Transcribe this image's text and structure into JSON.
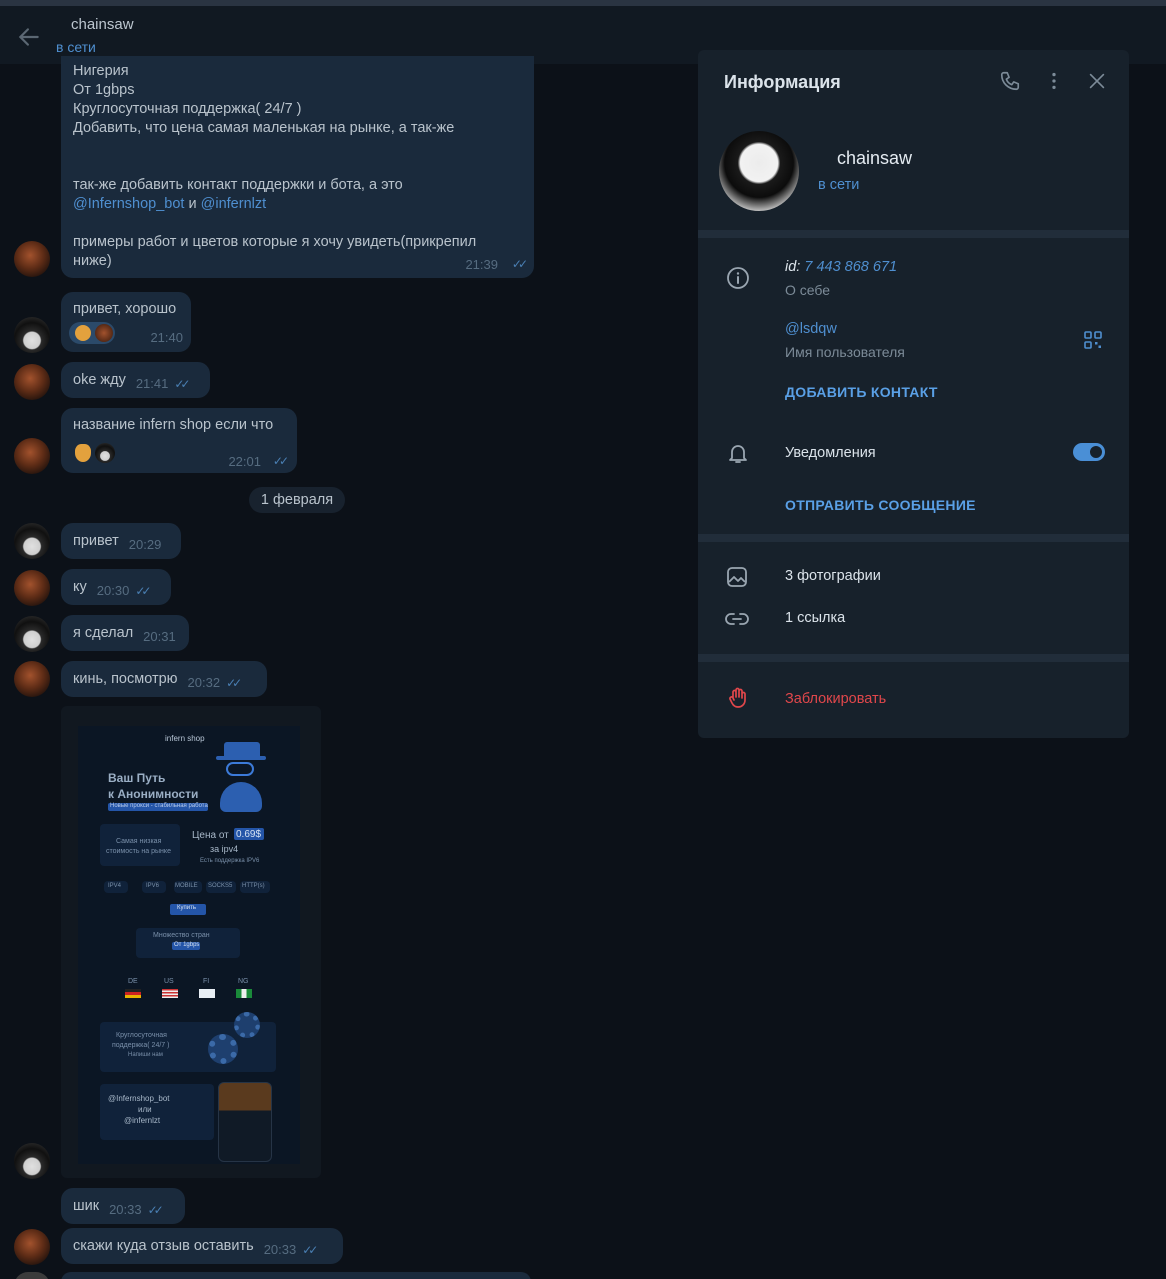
{
  "header": {
    "name": "chainsaw",
    "status": "в сети"
  },
  "top_message": {
    "lines": [
      "Нигерия",
      "От 1gbps",
      "Круглосуточная поддержка( 24/7 )",
      "Добавить, что цена самая маленькая на рынке, а так-же",
      "",
      "",
      "так-же добавить контакт поддержки и бота, а это"
    ],
    "mention_bot": "@Infernshop_bot",
    "and": "и",
    "mention_user": "@infernlzt",
    "line_examples_1": "примеры работ и цветов которые я хочу увидеть(прикрепил",
    "line_examples_2": "ниже)",
    "time": "21:39"
  },
  "messages": [
    {
      "text": "привет, хорошо",
      "time": "21:40"
    },
    {
      "text": "oke жду",
      "time": "21:41"
    },
    {
      "text": "название infern shop если что",
      "time": "22:01"
    },
    {
      "text": "привет",
      "time": "20:29"
    },
    {
      "text": "ку",
      "time": "20:30"
    },
    {
      "text": "я сделал",
      "time": "20:31"
    },
    {
      "text": "кинь, посмотрю",
      "time": "20:32"
    },
    {
      "text": "шик",
      "time": "20:33"
    },
    {
      "text": "скажи куда отзыв оставить",
      "time": "20:33"
    }
  ],
  "date_divider": "1 февраля",
  "photo": {
    "brand": "infern shop",
    "headline_1": "Ваш Путь",
    "headline_2": "к Анонимности",
    "tagline": "Новые прокси - стабильная работа",
    "lowest_1": "Самая низкая",
    "lowest_2": "стоимость на рынке",
    "price_label": "Цена от",
    "price_value": "0.69$",
    "price_for": "за ipv4",
    "ipv6_note": "Есть поддержка IPV6",
    "protocols": [
      "IPV4",
      "IPV6",
      "MOBILE",
      "SOCKS5",
      "HTTP(s)"
    ],
    "buy": "Купить",
    "countries_title": "Множество стран",
    "countries_speed": "От 1gbps",
    "countries": [
      "DE",
      "US",
      "FI",
      "NG"
    ],
    "support_1": "Круглосуточная",
    "support_2": "поддержка( 24/7 )",
    "support_3": "Напиши нам",
    "contact_bot": "@Infernshop_bot",
    "contact_or": "или",
    "contact_user": "@infernlzt"
  },
  "panel": {
    "title": "Информация",
    "name": "chainsaw",
    "status": "в сети",
    "id_label": "id:",
    "id_value": "7 443 868 671",
    "about": "О себе",
    "username": "@lsdqw",
    "username_label": "Имя пользователя",
    "add_contact": "ДОБАВИТЬ КОНТАКТ",
    "notifications": "Уведомления",
    "notifications_on": true,
    "send_message": "ОТПРАВИТЬ СООБЩЕНИЕ",
    "photos": "3 фотографии",
    "links": "1 ссылка",
    "block": "Заблокировать"
  },
  "colors": {
    "accent": "#4f8fd0",
    "danger": "#e0474b",
    "bubble": "#1a2a3c",
    "panel": "#17212b"
  }
}
